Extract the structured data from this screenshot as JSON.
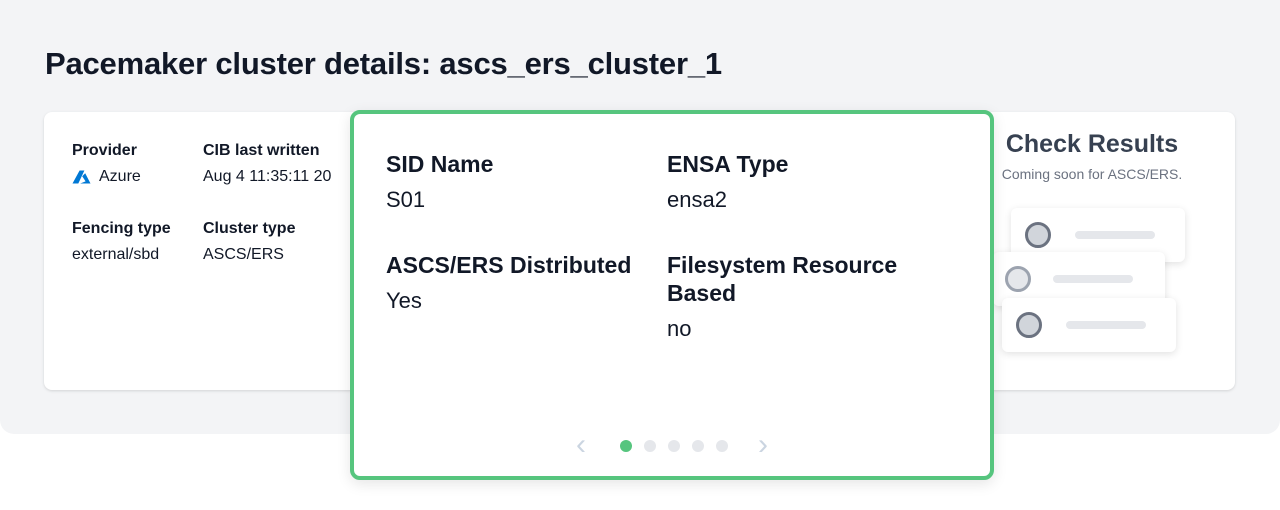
{
  "page": {
    "title": "Pacemaker cluster details: ascs_ers_cluster_1"
  },
  "summary": {
    "provider_label": "Provider",
    "provider_value": "Azure",
    "provider_icon": "azure-icon",
    "cib_label": "CIB last written",
    "cib_value": "Aug 4 11:35:11 20",
    "fencing_label": "Fencing type",
    "fencing_value": "external/sbd",
    "cluster_type_label": "Cluster type",
    "cluster_type_value": "ASCS/ERS"
  },
  "check_results": {
    "title": "Check Results",
    "subtitle": "Coming soon for ASCS/ERS."
  },
  "detail": {
    "sid_label": "SID Name",
    "sid_value": "S01",
    "ensa_label": "ENSA Type",
    "ensa_value": "ensa2",
    "distributed_label": "ASCS/ERS Distributed",
    "distributed_value": "Yes",
    "filesystem_label": "Filesystem Resource Based",
    "filesystem_value": "no",
    "pager": {
      "prev_icon": "chevron-left-icon",
      "next_icon": "chevron-right-icon",
      "page_count": 5,
      "active_page": 1
    }
  },
  "colors": {
    "accent": "#56c57e",
    "azure": "#0078d4",
    "background": "#f3f4f6"
  }
}
